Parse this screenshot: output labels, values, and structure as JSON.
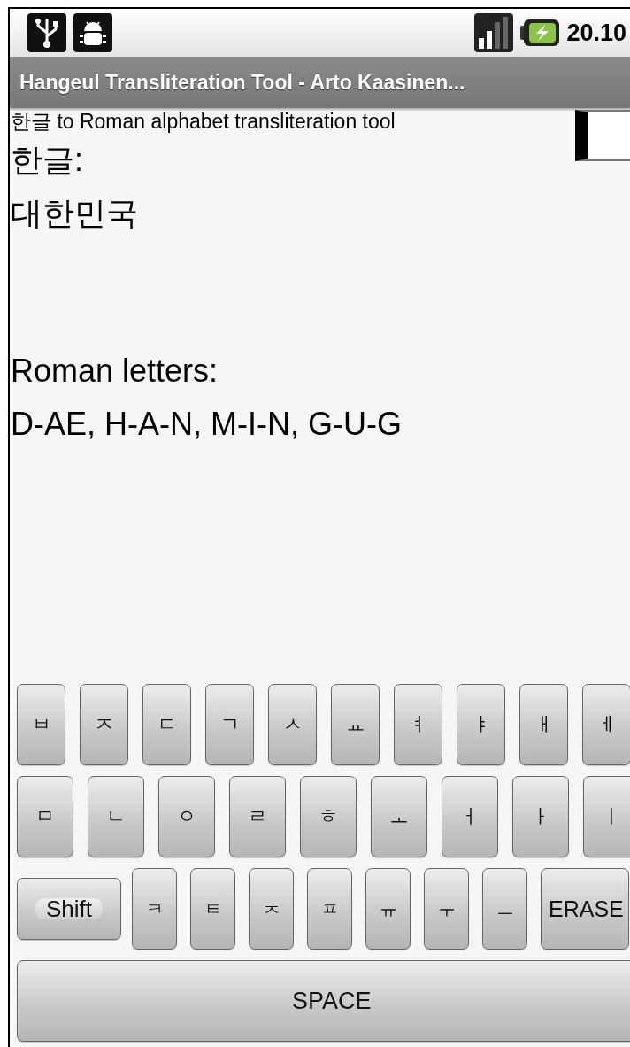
{
  "status_bar": {
    "time": "20.10"
  },
  "title_bar": {
    "title": "Hangeul Transliteration Tool - Arto Kaasinen..."
  },
  "content": {
    "subtitle": "한글 to Roman alphabet transliteration tool",
    "input_label": "한글:",
    "input_value": "대한민국",
    "output_label": "Roman letters:",
    "output_value": "D-AE, H-A-N, M-I-N, G-U-G"
  },
  "keyboard": {
    "rows": [
      [
        {
          "label": "ㅂ",
          "kind": "letter"
        },
        {
          "label": "ㅈ",
          "kind": "letter"
        },
        {
          "label": "ㄷ",
          "kind": "letter"
        },
        {
          "label": "ㄱ",
          "kind": "letter"
        },
        {
          "label": "ㅅ",
          "kind": "letter"
        },
        {
          "label": "ㅛ",
          "kind": "letter"
        },
        {
          "label": "ㅕ",
          "kind": "letter"
        },
        {
          "label": "ㅑ",
          "kind": "letter"
        },
        {
          "label": "ㅐ",
          "kind": "letter"
        },
        {
          "label": "ㅔ",
          "kind": "letter"
        }
      ],
      [
        {
          "label": "ㅁ",
          "kind": "letter"
        },
        {
          "label": "ㄴ",
          "kind": "letter"
        },
        {
          "label": "ㅇ",
          "kind": "letter"
        },
        {
          "label": "ㄹ",
          "kind": "letter"
        },
        {
          "label": "ㅎ",
          "kind": "letter"
        },
        {
          "label": "ㅗ",
          "kind": "letter"
        },
        {
          "label": "ㅓ",
          "kind": "letter"
        },
        {
          "label": "ㅏ",
          "kind": "letter"
        },
        {
          "label": "ㅣ",
          "kind": "letter"
        }
      ],
      [
        {
          "label": "Shift",
          "kind": "shift"
        },
        {
          "label": "ㅋ",
          "kind": "letter"
        },
        {
          "label": "ㅌ",
          "kind": "letter"
        },
        {
          "label": "ㅊ",
          "kind": "letter"
        },
        {
          "label": "ㅍ",
          "kind": "letter"
        },
        {
          "label": "ㅠ",
          "kind": "letter"
        },
        {
          "label": "ㅜ",
          "kind": "letter"
        },
        {
          "label": "ㅡ",
          "kind": "letter"
        },
        {
          "label": "ERASE",
          "kind": "erase"
        }
      ]
    ],
    "space_bar": {
      "label": "SPACE"
    }
  }
}
